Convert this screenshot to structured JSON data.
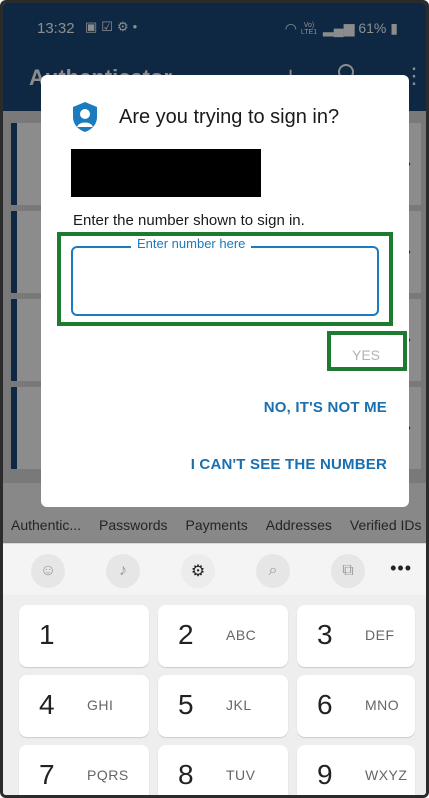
{
  "status_bar": {
    "time": "13:32",
    "notification_icons": [
      "message-icon",
      "checkbox-mail-icon",
      "settings-notify-icon",
      "dot-icon"
    ],
    "network_top": "Vo)",
    "network_bottom": "LTE1",
    "battery": "61%"
  },
  "app_bar": {
    "title": "Authenticator",
    "add_icon": "plus-icon",
    "search_icon": "search-icon",
    "more_icon": "kebab-icon"
  },
  "bottom_tabs": [
    "Authentic...",
    "Passwords",
    "Payments",
    "Addresses",
    "Verified IDs"
  ],
  "dialog": {
    "title": "Are you trying to sign in?",
    "instructions": "Enter the number shown to sign in.",
    "input_legend": "Enter number here",
    "input_value": "",
    "yes_label": "YES",
    "not_me_label": "NO, IT'S NOT ME",
    "cant_see_label": "I CAN'T SEE THE NUMBER"
  },
  "keyboard": {
    "toolbar_icons": [
      "emoji-icon",
      "microphone-icon",
      "settings-icon",
      "search-icon",
      "translate-icon"
    ],
    "more_label": "•••",
    "keys": [
      {
        "num": "1",
        "letters": ""
      },
      {
        "num": "2",
        "letters": "ABC"
      },
      {
        "num": "3",
        "letters": "DEF"
      },
      {
        "num": "4",
        "letters": "GHI"
      },
      {
        "num": "5",
        "letters": "JKL"
      },
      {
        "num": "6",
        "letters": "MNO"
      },
      {
        "num": "7",
        "letters": "PQRS"
      },
      {
        "num": "8",
        "letters": "TUV"
      },
      {
        "num": "9",
        "letters": "WXYZ"
      }
    ]
  },
  "colors": {
    "app_blue": "#1b4a7a",
    "accent_blue": "#1a7bbf",
    "highlight_green": "#1e7a2f",
    "disabled_gray": "#b3b3b3"
  }
}
